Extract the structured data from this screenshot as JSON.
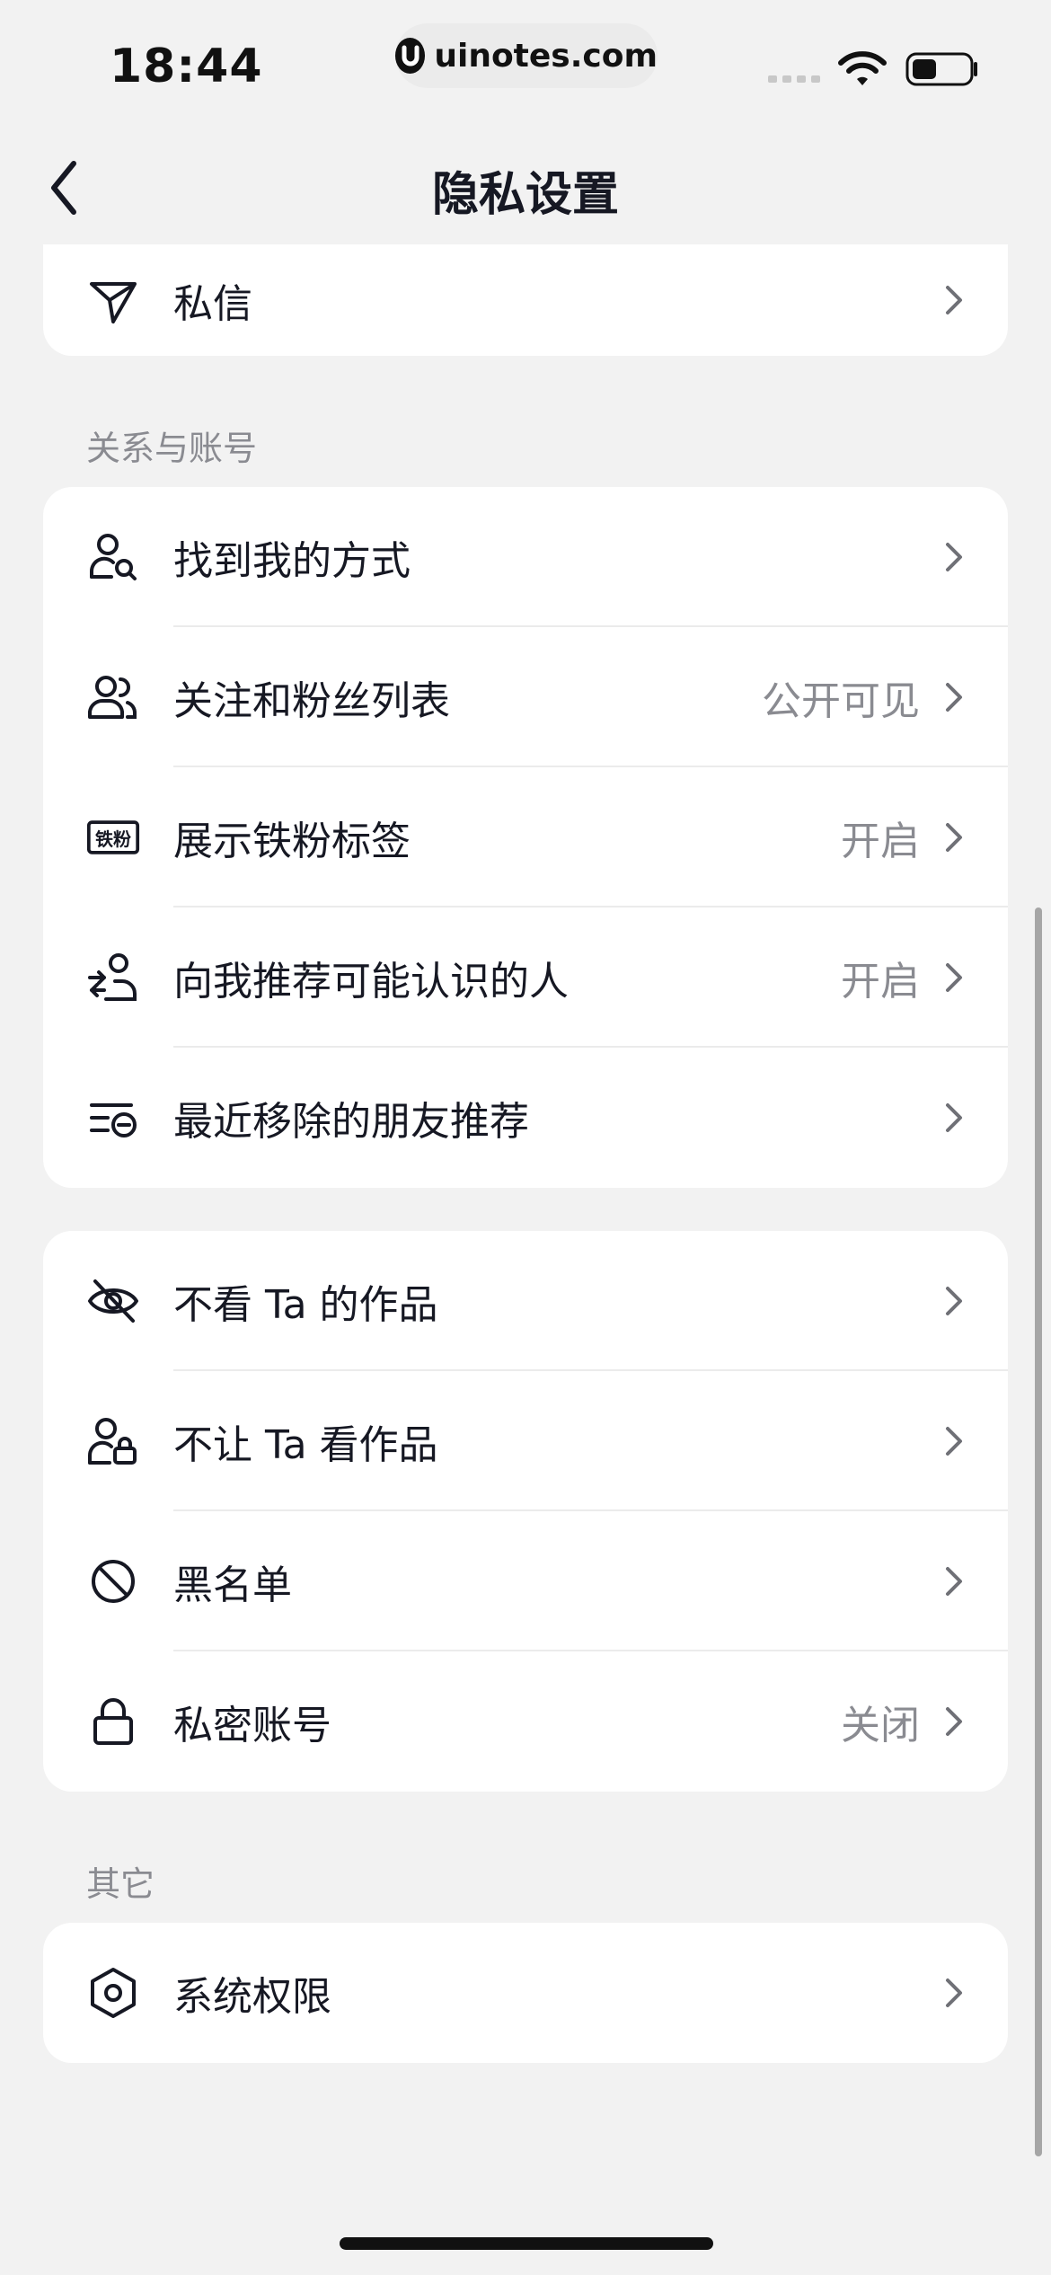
{
  "status_bar": {
    "time": "18:44",
    "url": "uinotes.com"
  },
  "nav": {
    "title": "隐私设置"
  },
  "top_card": {
    "items": [
      {
        "label": "私信",
        "icon": "paper-plane-icon"
      }
    ]
  },
  "sections": {
    "relations_title": "关系与账号",
    "other_title": "其它"
  },
  "relations_card": {
    "items": [
      {
        "label": "找到我的方式",
        "value": "",
        "icon": "user-search-icon"
      },
      {
        "label": "关注和粉丝列表",
        "value": "公开可见",
        "icon": "users-icon"
      },
      {
        "label": "展示铁粉标签",
        "value": "开启",
        "icon": "fan-badge-icon",
        "badge_text": "铁粉"
      },
      {
        "label": "向我推荐可能认识的人",
        "value": "开启",
        "icon": "user-recommend-icon"
      },
      {
        "label": "最近移除的朋友推荐",
        "value": "",
        "icon": "list-remove-icon"
      }
    ]
  },
  "privacy_card": {
    "items": [
      {
        "label": "不看 Ta 的作品",
        "value": "",
        "icon": "eye-off-icon"
      },
      {
        "label": "不让 Ta 看作品",
        "value": "",
        "icon": "user-lock-icon"
      },
      {
        "label": "黑名单",
        "value": "",
        "icon": "block-icon"
      },
      {
        "label": "私密账号",
        "value": "关闭",
        "icon": "lock-icon"
      }
    ]
  },
  "other_card": {
    "items": [
      {
        "label": "系统权限",
        "value": "",
        "icon": "hexagon-settings-icon"
      }
    ]
  }
}
